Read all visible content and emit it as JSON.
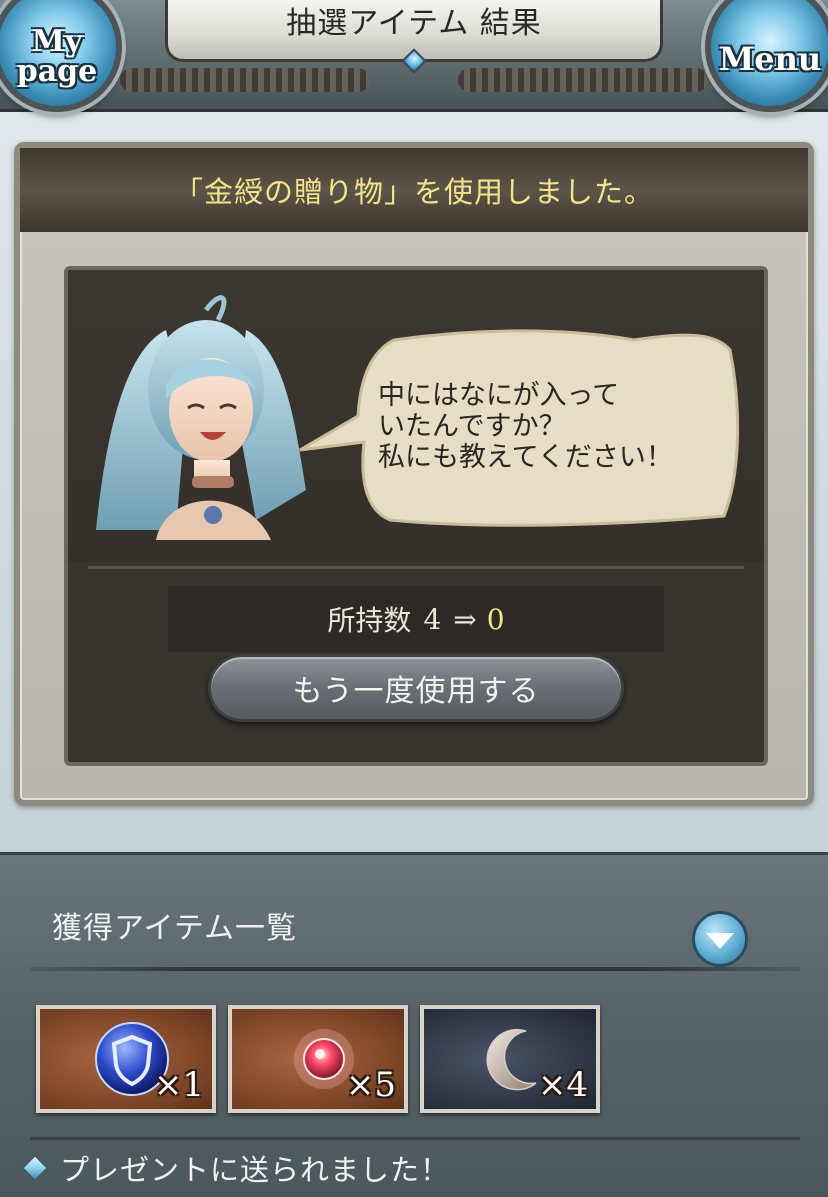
{
  "header": {
    "title": "抽選アイテム 結果",
    "mypage_label": "My\npage",
    "menu_label": "Menu"
  },
  "panel": {
    "title": "「金綬の贈り物」を使用しました。",
    "speech": "中にはなにが入って\nいたんですか？\n私にも教えてください！",
    "count": {
      "label": "所持数",
      "before": "4",
      "arrow": "⇒",
      "after": "0"
    },
    "retry_label": "もう一度使用する"
  },
  "acquired": {
    "title": "獲得アイテム一覧",
    "items": [
      {
        "icon": "blue-shield-orb-icon",
        "qty": "×1"
      },
      {
        "icon": "red-orb-icon",
        "qty": "×5"
      },
      {
        "icon": "crescent-moon-icon",
        "qty": "×4"
      }
    ],
    "sent_message": "プレゼントに送られました！"
  },
  "colors": {
    "accent_yellow": "#f3e48a",
    "panel_dark": "#3a342f",
    "bottom_bg": "#5a666c"
  }
}
